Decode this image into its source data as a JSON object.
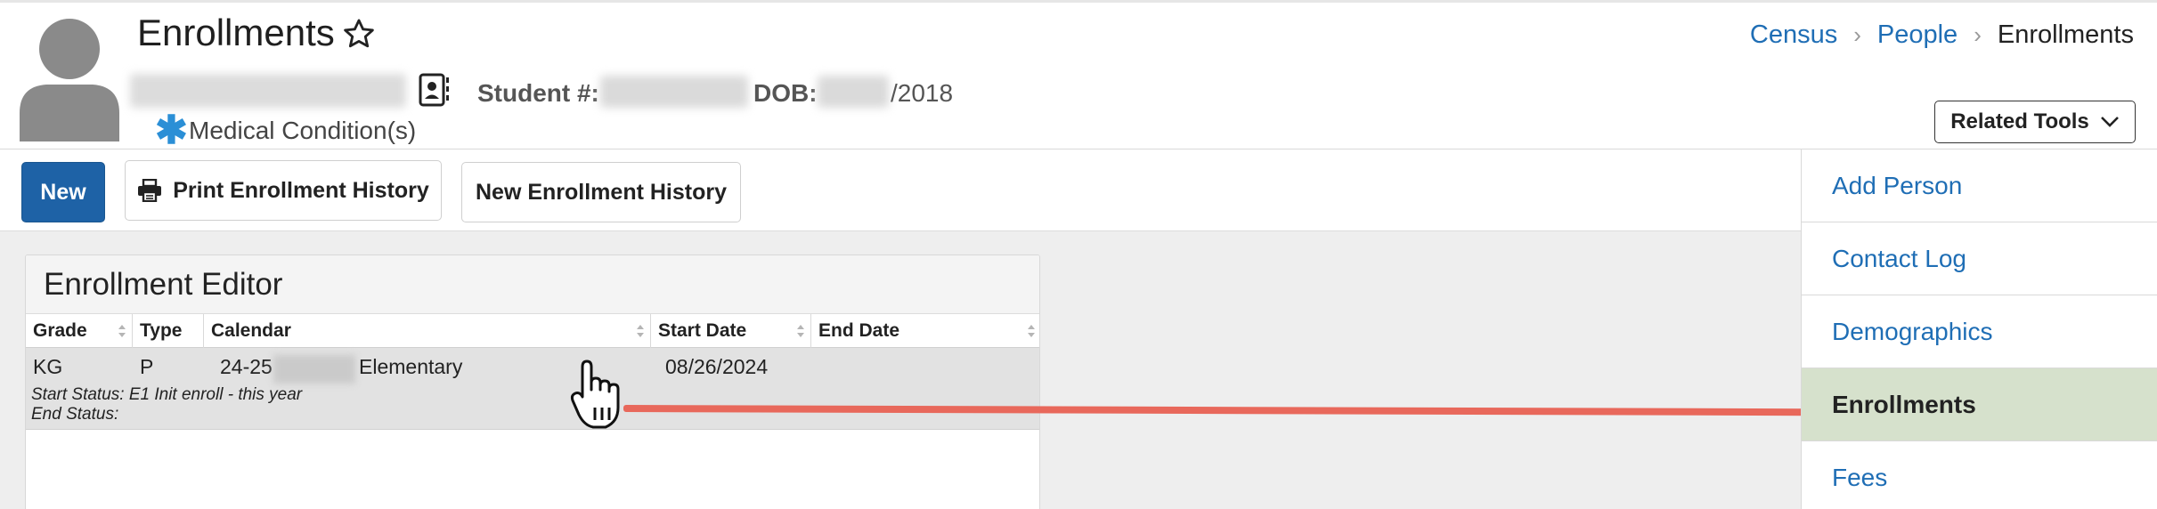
{
  "header": {
    "title": "Enrollments",
    "student_label": "Student #:",
    "dob_label": "DOB:",
    "dob_year": "/2018",
    "medical_label": "Medical Condition(s)"
  },
  "breadcrumb": [
    "Census",
    "People",
    "Enrollments"
  ],
  "related_tools_label": "Related Tools",
  "toolbar": {
    "new_label": "New",
    "print_label": "Print Enrollment History",
    "history_label": "New Enrollment History"
  },
  "editor": {
    "title": "Enrollment Editor",
    "columns": [
      "Grade",
      "Type",
      "Calendar",
      "Start Date",
      "End Date"
    ],
    "rows": [
      {
        "grade": "KG",
        "type": "P",
        "calendar_prefix": "24-25",
        "calendar_suffix": "Elementary",
        "start_date": "08/26/2024",
        "end_date": "",
        "start_status": "Start Status: E1 Init enroll - this year",
        "end_status": "End Status:"
      }
    ]
  },
  "sidebar": {
    "items": [
      {
        "label": "Add Person",
        "active": false
      },
      {
        "label": "Contact Log",
        "active": false
      },
      {
        "label": "Demographics",
        "active": false
      },
      {
        "label": "Enrollments",
        "active": true
      },
      {
        "label": "Fees",
        "active": false
      }
    ]
  },
  "colors": {
    "accent": "#1e62a6",
    "link": "#1f6eb5",
    "active_bg": "#d6e1cc",
    "pointer": "#e8685b",
    "medical_icon": "#2b8fd6"
  }
}
